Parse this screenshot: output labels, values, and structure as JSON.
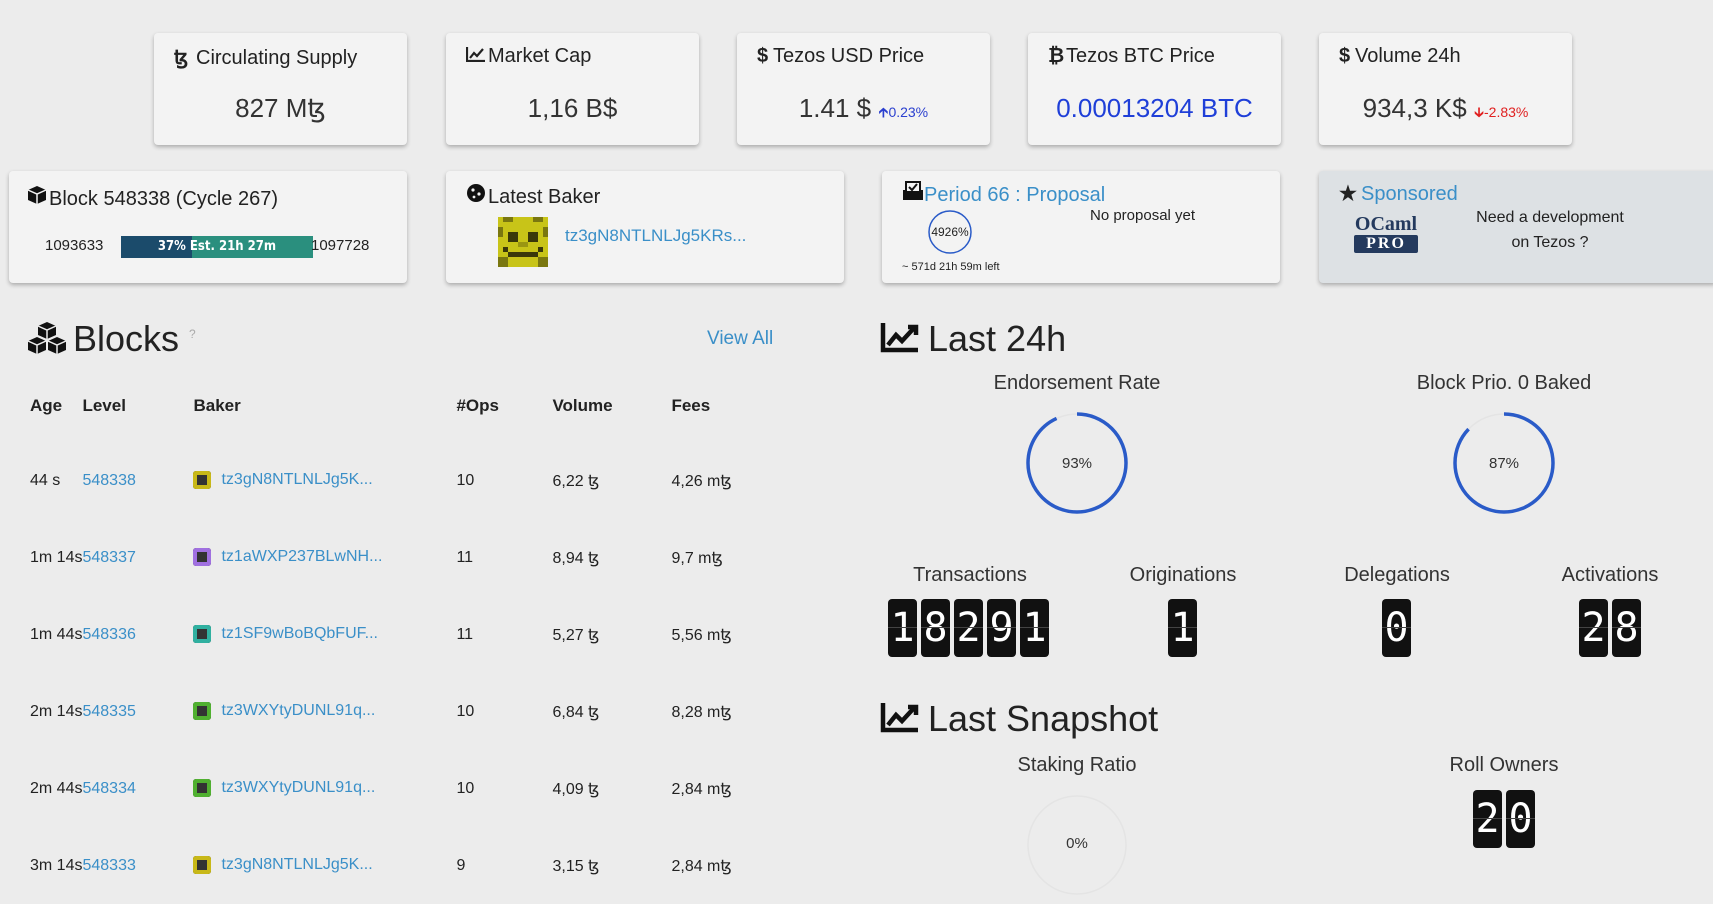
{
  "stats": {
    "supply": {
      "icon": "ꜩ",
      "title": "Circulating Supply",
      "value": "827 Mꜩ"
    },
    "marketcap": {
      "icon": "chart-icon",
      "title": "Market Cap",
      "value": "1,16 B$"
    },
    "usd": {
      "icon": "$",
      "title": "Tezos USD Price",
      "value": "1.41 $",
      "delta": "0.23%"
    },
    "btc": {
      "icon": "₿",
      "title": "Tezos BTC Price",
      "value": "0.00013204 BTC"
    },
    "volume": {
      "icon": "$",
      "title": "Volume 24h",
      "value": "934,3 K$",
      "delta": "-2.83%"
    }
  },
  "block_card": {
    "title": "Block 548338 (Cycle 267)",
    "start": "1093633",
    "end": "1097728",
    "progress_text": "37% Est. 21h 27m",
    "progress_pct": 37
  },
  "baker_card": {
    "title": "Latest Baker",
    "address": "tz3gN8NTLNLJg5KRs..."
  },
  "period_card": {
    "title": "Period 66 : Proposal",
    "status": "No proposal yet",
    "gauge": "4926%",
    "remaining": "~ 571d 21h 59m left"
  },
  "sponsored_card": {
    "title": "Sponsored",
    "logo_top": "OCaml",
    "logo_bottom": "PRO",
    "text_line1": "Need a development",
    "text_line2": "on Tezos ?"
  },
  "blocks": {
    "title": "Blocks",
    "help": "?",
    "view_all": "View All",
    "columns": [
      "Age",
      "Level",
      "Baker",
      "#Ops",
      "Volume",
      "Fees"
    ],
    "rows": [
      {
        "age": "44 s",
        "level": "548338",
        "baker": "tz3gN8NTLNLJg5K...",
        "ops": "10",
        "volume": "6,22 ꜩ",
        "fees": "4,26 mꜩ",
        "color": "#c8b818"
      },
      {
        "age": "1m 14s",
        "level": "548337",
        "baker": "tz1aWXP237BLwNH...",
        "ops": "11",
        "volume": "8,94 ꜩ",
        "fees": "9,7 mꜩ",
        "color": "#a070e0"
      },
      {
        "age": "1m 44s",
        "level": "548336",
        "baker": "tz1SF9wBoBQbFUF...",
        "ops": "11",
        "volume": "5,27 ꜩ",
        "fees": "5,56 mꜩ",
        "color": "#30b0a0"
      },
      {
        "age": "2m 14s",
        "level": "548335",
        "baker": "tz3WXYtyDUNL91q...",
        "ops": "10",
        "volume": "6,84 ꜩ",
        "fees": "8,28 mꜩ",
        "color": "#50b030"
      },
      {
        "age": "2m 44s",
        "level": "548334",
        "baker": "tz3WXYtyDUNL91q...",
        "ops": "10",
        "volume": "4,09 ꜩ",
        "fees": "2,84 mꜩ",
        "color": "#50b030"
      },
      {
        "age": "3m 14s",
        "level": "548333",
        "baker": "tz3gN8NTLNLJg5K...",
        "ops": "9",
        "volume": "3,15 ꜩ",
        "fees": "2,84 mꜩ",
        "color": "#c8b818"
      }
    ]
  },
  "last24": {
    "title": "Last 24h",
    "endorsement": {
      "label": "Endorsement Rate",
      "value": "93%",
      "pct": 93
    },
    "prio0": {
      "label": "Block Prio. 0 Baked",
      "value": "87%",
      "pct": 87
    },
    "transactions": {
      "label": "Transactions",
      "digits": [
        "1",
        "8",
        "2",
        "9",
        "1"
      ]
    },
    "originations": {
      "label": "Originations",
      "digits": [
        "1"
      ]
    },
    "delegations": {
      "label": "Delegations",
      "digits": [
        "0"
      ]
    },
    "activations": {
      "label": "Activations",
      "digits": [
        "2",
        "8"
      ]
    }
  },
  "snapshot": {
    "title": "Last Snapshot",
    "staking": {
      "label": "Staking Ratio",
      "value": "0%",
      "pct": 0
    },
    "roll_owners": {
      "label": "Roll Owners",
      "digits": [
        "2",
        "0"
      ]
    }
  },
  "colors": {
    "link": "#3a8fc8",
    "gauge": "#2a5bc8",
    "progress": "#2a8f7e",
    "up": "#2a3fcf",
    "down": "#e02020"
  }
}
